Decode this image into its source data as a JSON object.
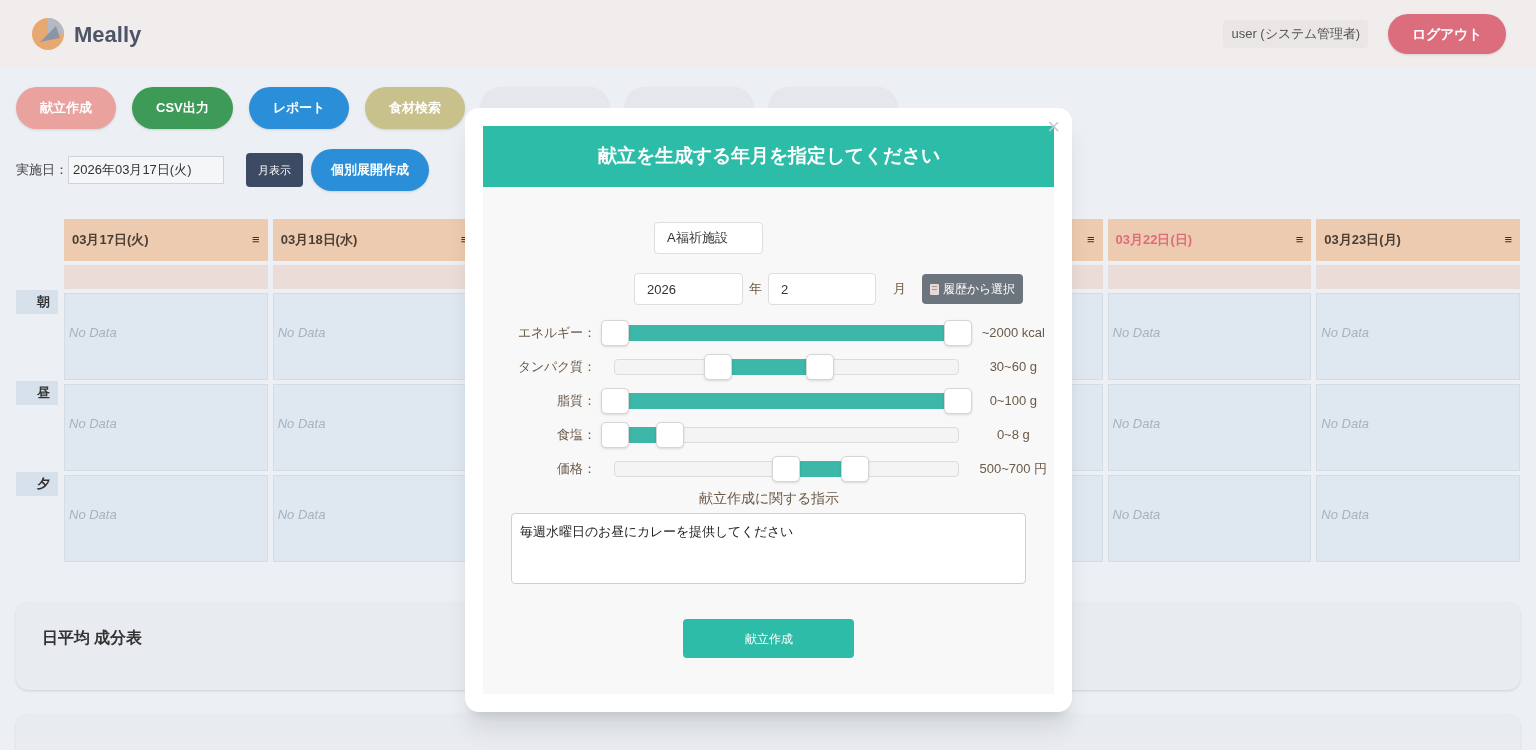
{
  "app": {
    "logo": "Meally",
    "user": "user (システム管理者)",
    "logout": "ログアウト"
  },
  "nav": [
    {
      "label": "献立作成",
      "color": "#e9a29e"
    },
    {
      "label": "CSV出力",
      "color": "#3e9a57"
    },
    {
      "label": "レポート",
      "color": "#2a8fd8"
    },
    {
      "label": "食材検索",
      "color": "#c9c18c"
    },
    {
      "color": "#e6e7ec"
    },
    {
      "color": "#e6e7ec"
    },
    {
      "color": "#e6e7ec"
    }
  ],
  "date_filter": {
    "label": "実施日：",
    "value": "2026年03月17日(火)",
    "month_button": "月表示",
    "expand_button": "個別展開作成"
  },
  "calendar": {
    "meals": [
      "朝",
      "昼",
      "夕"
    ],
    "days": [
      {
        "kind": "day",
        "label": "03月17日(火)",
        "holiday": false,
        "menu": "≡",
        "cells": [
          "No Data",
          "No Data",
          "No Data"
        ]
      },
      {
        "kind": "day",
        "label": "03月18日(水)",
        "holiday": false,
        "menu": "≡",
        "cells": [
          "No Data",
          "No Data",
          "No Data"
        ]
      },
      {
        "kind": "covered",
        "menu": "≡"
      },
      {
        "kind": "day",
        "label": "03月22日(日)",
        "holiday": true,
        "menu": "≡",
        "cells": [
          "No Data",
          "No Data",
          "No Data"
        ]
      },
      {
        "kind": "day",
        "label": "03月23日(月)",
        "holiday": false,
        "menu": "≡",
        "cells": [
          "No Data",
          "No Data",
          "No Data"
        ]
      }
    ]
  },
  "summary": {
    "title": "日平均 成分表"
  },
  "dialog": {
    "title": "献立を生成する年月を指定してください",
    "close": "×",
    "facility": "A福祈施設",
    "year": "2026",
    "year_unit": "年",
    "month": "2",
    "month_unit": "月",
    "history_button": "履歴から選択",
    "sliders": [
      {
        "label": "エネルギー：",
        "start": {
          "level": 0
        },
        "end": {
          "level": 1
        },
        "reading": "~2000 kcal"
      },
      {
        "label": "タンパク質：",
        "start": {
          "level": 0.3
        },
        "end": {
          "level": 0.6
        },
        "reading": "30~60 g"
      },
      {
        "label": "脂質：",
        "start": {
          "level": 0
        },
        "end": {
          "level": 1
        },
        "reading": "0~100 g"
      },
      {
        "label": "食塩：",
        "start": {
          "level": 0
        },
        "end": {
          "level": 0.16
        },
        "reading": "0~8 g"
      },
      {
        "label": "価格：",
        "start": {
          "level": 0.5
        },
        "end": {
          "level": 0.7
        },
        "reading": "500~700 円"
      }
    ],
    "instruction_label": "献立作成に関する指示",
    "instruction": "毎週水曜日のお昼にカレーを提供してください",
    "submit": "献立作成"
  }
}
